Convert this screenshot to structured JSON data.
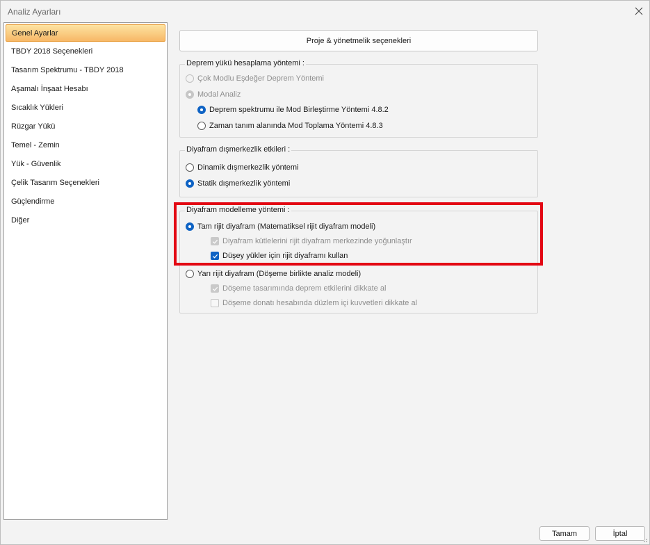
{
  "window": {
    "title": "Analiz Ayarları"
  },
  "nav": {
    "items": [
      {
        "label": "Genel Ayarlar",
        "selected": true
      },
      {
        "label": "TBDY 2018 Seçenekleri"
      },
      {
        "label": "Tasarım Spektrumu - TBDY 2018"
      },
      {
        "label": "Aşamalı İnşaat Hesabı"
      },
      {
        "label": "Sıcaklık Yükleri"
      },
      {
        "label": "Rüzgar Yükü"
      },
      {
        "label": "Temel - Zemin"
      },
      {
        "label": "Yük - Güvenlik"
      },
      {
        "label": "Çelik Tasarım Seçenekleri"
      },
      {
        "label": "Güçlendirme"
      },
      {
        "label": "Diğer"
      }
    ]
  },
  "top_button": {
    "label": "Proje & yönetmelik seçenekleri"
  },
  "deprem_group": {
    "title": "Deprem yükü hesaplama yöntemi :",
    "options": [
      {
        "label": "Çok Modlu Eşdeğer Deprem Yöntemi",
        "checked": false,
        "disabled": true
      },
      {
        "label": "Modal Analiz",
        "checked": true,
        "disabled": true
      },
      {
        "label": "Deprem spektrumu ile Mod Birleştirme Yöntemi 4.8.2",
        "checked": true,
        "disabled": false
      },
      {
        "label": "Zaman tanım alanında Mod Toplama Yöntemi 4.8.3",
        "checked": false,
        "disabled": false
      }
    ]
  },
  "eksantrisite_group": {
    "title": "Diyafram dışmerkezlik etkileri :",
    "options": [
      {
        "label": "Dinamik dışmerkezlik yöntemi",
        "checked": false
      },
      {
        "label": "Statik dışmerkezlik yöntemi",
        "checked": true
      }
    ]
  },
  "diyafram_group": {
    "title": "Diyafram modelleme yöntemi  :",
    "rigid": {
      "label": "Tam rijit diyafram (Matematiksel rijit diyafram modeli)",
      "checked": true
    },
    "rigid_checks": [
      {
        "label": "Diyafram kütlelerini rijit diyafram merkezinde yoğunlaştır",
        "checked": true,
        "disabled": true
      },
      {
        "label": "Düşey yükler için rijit diyaframı kullan",
        "checked": true,
        "disabled": false
      }
    ],
    "semi": {
      "label": "Yarı rijit diyafram (Döşeme birlikte analiz modeli)",
      "checked": false
    },
    "semi_checks": [
      {
        "label": "Döşeme tasarımında deprem etkilerini dikkate al",
        "checked": true,
        "disabled": true
      },
      {
        "label": "Döşeme donatı hesabında düzlem içi kuvvetleri dikkate al",
        "checked": false,
        "disabled": true
      }
    ]
  },
  "footer": {
    "ok_label": "Tamam",
    "cancel_label": "İptal"
  },
  "colors": {
    "accent": "#0f63c4",
    "highlight": "#e30613",
    "nav_selected": "#f7b867"
  }
}
